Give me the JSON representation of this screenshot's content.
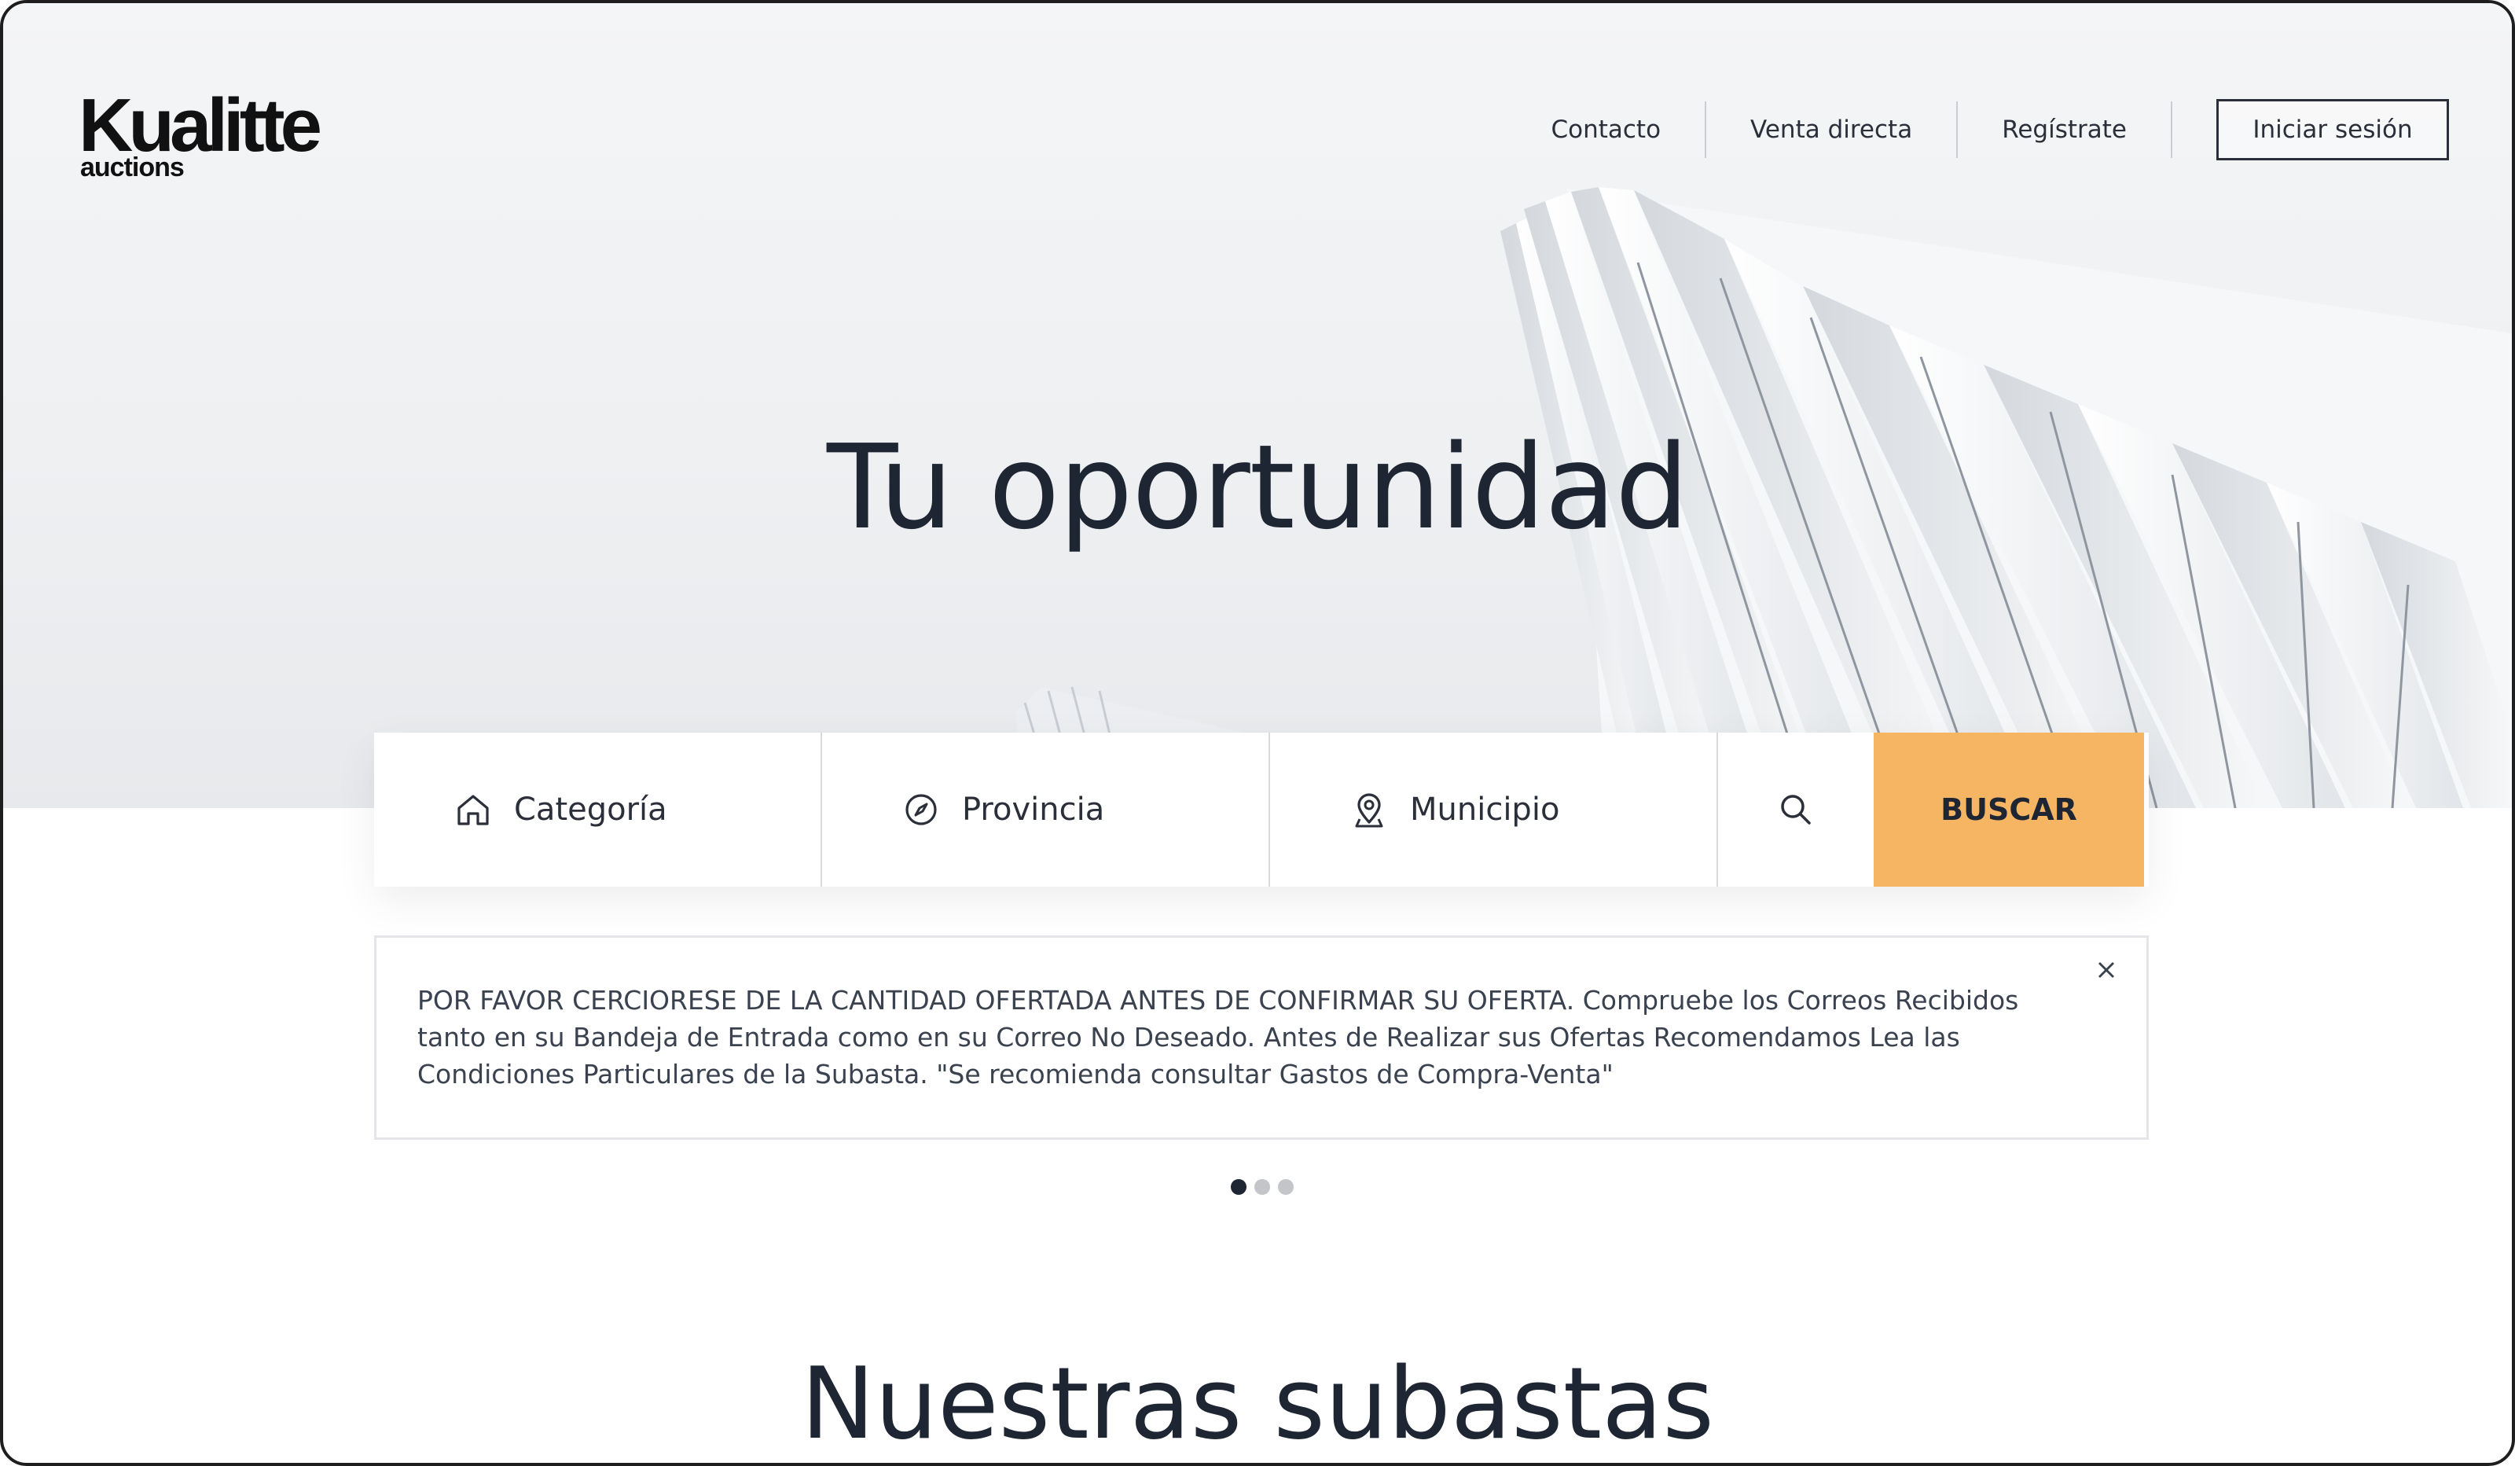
{
  "brand": {
    "logo_main": "Kualitte",
    "logo_sub": "auctions",
    "accent_color": "#f5b563"
  },
  "nav": {
    "items": [
      {
        "label": "Contacto"
      },
      {
        "label": "Venta directa"
      },
      {
        "label": "Regístrate"
      }
    ],
    "login_label": "Iniciar sesión"
  },
  "hero": {
    "title": "Tu oportunidad"
  },
  "search": {
    "fields": [
      {
        "label": "Categoría",
        "icon": "home-icon"
      },
      {
        "label": "Provincia",
        "icon": "compass-icon"
      },
      {
        "label": "Municipio",
        "icon": "map-pin-icon"
      }
    ],
    "search_icon": "search-icon",
    "button_label": "BUSCAR"
  },
  "notice": {
    "text": "POR FAVOR CERCIORESE DE LA CANTIDAD OFERTADA ANTES DE CONFIRMAR SU OFERTA. Compruebe los Correos Recibidos tanto en su Bandeja de Entrada como en su Correo No Deseado. Antes de Realizar sus Ofertas Recomendamos Lea las Condiciones Particulares de la Subasta. \"Se recomienda consultar Gastos de Compra-Venta\"",
    "close_icon": "close-icon"
  },
  "carousel": {
    "total_slides": 3,
    "active_slide": 1
  },
  "section": {
    "title": "Nuestras subastas"
  }
}
